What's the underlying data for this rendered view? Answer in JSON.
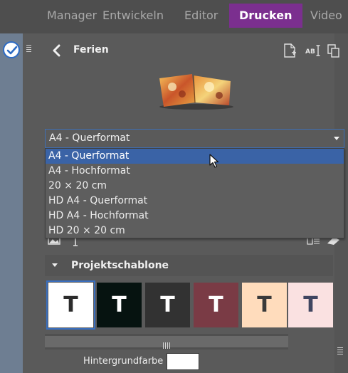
{
  "nav": {
    "tabs": [
      {
        "label": "Manager"
      },
      {
        "label": "Entwickeln"
      },
      {
        "label": "Editor"
      },
      {
        "label": "Drucken"
      },
      {
        "label": "Video"
      }
    ],
    "active": "Drucken",
    "active_color": "#7b2f8f"
  },
  "header": {
    "back_icon": "chevron-left-icon",
    "title": "Ferien",
    "icons": [
      "new-page-icon",
      "rename-icon",
      "duplicate-icon"
    ]
  },
  "format": {
    "selected": "A4 - Querformat",
    "options": [
      "A4 - Querformat",
      "A4 - Hochformat",
      "20 × 20 cm",
      "HD A4 - Querformat",
      "HD A4 - Hochformat",
      "HD 20 × 20 cm"
    ],
    "highlighted_index": 0
  },
  "section": {
    "title": "Projektschablone",
    "templates": [
      {
        "glyph": "T",
        "bg": "#ffffff",
        "fg": "#2b2b2b",
        "selected": true
      },
      {
        "glyph": "T",
        "bg": "#061310",
        "fg": "#ffffff",
        "selected": false
      },
      {
        "glyph": "T",
        "bg": "#323232",
        "fg": "#ffffff",
        "selected": false
      },
      {
        "glyph": "T",
        "bg": "#7a3b45",
        "fg": "#ffffff",
        "selected": false
      },
      {
        "glyph": "T",
        "bg": "#ffdcbc",
        "fg": "#3a3a3a",
        "selected": false
      },
      {
        "glyph": "T",
        "bg": "#fae1e1",
        "fg": "#3f4560",
        "selected": false
      }
    ]
  },
  "background": {
    "label": "Hintergrundfarbe",
    "color": "#ffffff"
  }
}
